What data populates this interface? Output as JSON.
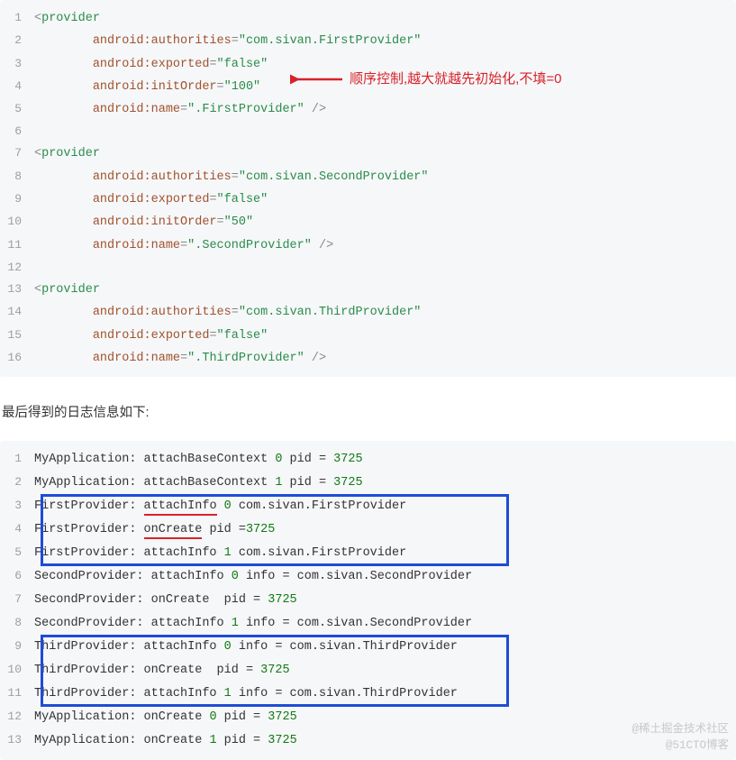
{
  "annotation": {
    "text": "顺序控制,越大就越先初始化,不填=0"
  },
  "sectionLabel": "最后得到的日志信息如下:",
  "watermarks": {
    "top": "@稀土掘金技术社区",
    "bottom": "@51CTO博客"
  },
  "xml": {
    "lines": [
      {
        "n": 1,
        "tokens": [
          {
            "t": "punc",
            "v": "<"
          },
          {
            "t": "tag",
            "v": "provider"
          }
        ]
      },
      {
        "n": 2,
        "tokens": [
          {
            "t": "txt",
            "v": "        "
          },
          {
            "t": "attr",
            "v": "android:authorities"
          },
          {
            "t": "punc",
            "v": "="
          },
          {
            "t": "str",
            "v": "\"com.sivan.FirstProvider\""
          }
        ]
      },
      {
        "n": 3,
        "tokens": [
          {
            "t": "txt",
            "v": "        "
          },
          {
            "t": "attr",
            "v": "android:exported"
          },
          {
            "t": "punc",
            "v": "="
          },
          {
            "t": "str",
            "v": "\"false\""
          }
        ]
      },
      {
        "n": 4,
        "tokens": [
          {
            "t": "txt",
            "v": "        "
          },
          {
            "t": "attr",
            "v": "android:initOrder"
          },
          {
            "t": "punc",
            "v": "="
          },
          {
            "t": "str",
            "v": "\"100\""
          }
        ]
      },
      {
        "n": 5,
        "tokens": [
          {
            "t": "txt",
            "v": "        "
          },
          {
            "t": "attr",
            "v": "android:name"
          },
          {
            "t": "punc",
            "v": "="
          },
          {
            "t": "str",
            "v": "\".FirstProvider\""
          },
          {
            "t": "txt",
            "v": " "
          },
          {
            "t": "punc",
            "v": "/>"
          }
        ]
      },
      {
        "n": 6,
        "tokens": []
      },
      {
        "n": 7,
        "tokens": [
          {
            "t": "punc",
            "v": "<"
          },
          {
            "t": "tag",
            "v": "provider"
          }
        ]
      },
      {
        "n": 8,
        "tokens": [
          {
            "t": "txt",
            "v": "        "
          },
          {
            "t": "attr",
            "v": "android:authorities"
          },
          {
            "t": "punc",
            "v": "="
          },
          {
            "t": "str",
            "v": "\"com.sivan.SecondProvider\""
          }
        ]
      },
      {
        "n": 9,
        "tokens": [
          {
            "t": "txt",
            "v": "        "
          },
          {
            "t": "attr",
            "v": "android:exported"
          },
          {
            "t": "punc",
            "v": "="
          },
          {
            "t": "str",
            "v": "\"false\""
          }
        ]
      },
      {
        "n": 10,
        "tokens": [
          {
            "t": "txt",
            "v": "        "
          },
          {
            "t": "attr",
            "v": "android:initOrder"
          },
          {
            "t": "punc",
            "v": "="
          },
          {
            "t": "str",
            "v": "\"50\""
          }
        ]
      },
      {
        "n": 11,
        "tokens": [
          {
            "t": "txt",
            "v": "        "
          },
          {
            "t": "attr",
            "v": "android:name"
          },
          {
            "t": "punc",
            "v": "="
          },
          {
            "t": "str",
            "v": "\".SecondProvider\""
          },
          {
            "t": "txt",
            "v": " "
          },
          {
            "t": "punc",
            "v": "/>"
          }
        ]
      },
      {
        "n": 12,
        "tokens": []
      },
      {
        "n": 13,
        "tokens": [
          {
            "t": "punc",
            "v": "<"
          },
          {
            "t": "tag",
            "v": "provider"
          }
        ]
      },
      {
        "n": 14,
        "tokens": [
          {
            "t": "txt",
            "v": "        "
          },
          {
            "t": "attr",
            "v": "android:authorities"
          },
          {
            "t": "punc",
            "v": "="
          },
          {
            "t": "str",
            "v": "\"com.sivan.ThirdProvider\""
          }
        ]
      },
      {
        "n": 15,
        "tokens": [
          {
            "t": "txt",
            "v": "        "
          },
          {
            "t": "attr",
            "v": "android:exported"
          },
          {
            "t": "punc",
            "v": "="
          },
          {
            "t": "str",
            "v": "\"false\""
          }
        ]
      },
      {
        "n": 16,
        "tokens": [
          {
            "t": "txt",
            "v": "        "
          },
          {
            "t": "attr",
            "v": "android:name"
          },
          {
            "t": "punc",
            "v": "="
          },
          {
            "t": "str",
            "v": "\".ThirdProvider\""
          },
          {
            "t": "txt",
            "v": " "
          },
          {
            "t": "punc",
            "v": "/>"
          }
        ]
      }
    ]
  },
  "log": {
    "lines": [
      {
        "n": 1,
        "segs": [
          {
            "t": "txt",
            "v": "MyApplication: attachBaseContext "
          },
          {
            "t": "num",
            "v": "0"
          },
          {
            "t": "txt",
            "v": " pid = "
          },
          {
            "t": "num",
            "v": "3725"
          }
        ]
      },
      {
        "n": 2,
        "segs": [
          {
            "t": "txt",
            "v": "MyApplication: attachBaseContext "
          },
          {
            "t": "num",
            "v": "1"
          },
          {
            "t": "txt",
            "v": " pid = "
          },
          {
            "t": "num",
            "v": "3725"
          }
        ]
      },
      {
        "n": 3,
        "segs": [
          {
            "t": "txt",
            "v": "FirstProvider: "
          },
          {
            "t": "ul",
            "v": "attachInfo"
          },
          {
            "t": "txt",
            "v": " "
          },
          {
            "t": "num",
            "v": "0"
          },
          {
            "t": "txt",
            "v": " com.sivan.FirstProvider"
          }
        ]
      },
      {
        "n": 4,
        "segs": [
          {
            "t": "txt",
            "v": "FirstProvider: "
          },
          {
            "t": "ul",
            "v": "onCreate"
          },
          {
            "t": "txt",
            "v": " pid ="
          },
          {
            "t": "num",
            "v": "3725"
          }
        ]
      },
      {
        "n": 5,
        "segs": [
          {
            "t": "txt",
            "v": "FirstProvider: attachInfo "
          },
          {
            "t": "num",
            "v": "1"
          },
          {
            "t": "txt",
            "v": " com.sivan.FirstProvider"
          }
        ]
      },
      {
        "n": 6,
        "segs": [
          {
            "t": "txt",
            "v": "SecondProvider: attachInfo "
          },
          {
            "t": "num",
            "v": "0"
          },
          {
            "t": "txt",
            "v": " info = com.sivan.SecondProvider"
          }
        ]
      },
      {
        "n": 7,
        "segs": [
          {
            "t": "txt",
            "v": "SecondProvider: onCreate  pid = "
          },
          {
            "t": "num",
            "v": "3725"
          }
        ]
      },
      {
        "n": 8,
        "segs": [
          {
            "t": "txt",
            "v": "SecondProvider: attachInfo "
          },
          {
            "t": "num",
            "v": "1"
          },
          {
            "t": "txt",
            "v": " info = com.sivan.SecondProvider"
          }
        ]
      },
      {
        "n": 9,
        "segs": [
          {
            "t": "txt",
            "v": "ThirdProvider: attachInfo "
          },
          {
            "t": "num",
            "v": "0"
          },
          {
            "t": "txt",
            "v": " info = com.sivan.ThirdProvider"
          }
        ]
      },
      {
        "n": 10,
        "segs": [
          {
            "t": "txt",
            "v": "ThirdProvider: onCreate  pid = "
          },
          {
            "t": "num",
            "v": "3725"
          }
        ]
      },
      {
        "n": 11,
        "segs": [
          {
            "t": "txt",
            "v": "ThirdProvider: attachInfo "
          },
          {
            "t": "num",
            "v": "1"
          },
          {
            "t": "txt",
            "v": " info = com.sivan.ThirdProvider"
          }
        ]
      },
      {
        "n": 12,
        "segs": [
          {
            "t": "txt",
            "v": "MyApplication: onCreate "
          },
          {
            "t": "num",
            "v": "0"
          },
          {
            "t": "txt",
            "v": " pid = "
          },
          {
            "t": "num",
            "v": "3725"
          }
        ]
      },
      {
        "n": 13,
        "segs": [
          {
            "t": "txt",
            "v": "MyApplication: onCreate "
          },
          {
            "t": "num",
            "v": "1"
          },
          {
            "t": "txt",
            "v": " pid = "
          },
          {
            "t": "num",
            "v": "3725"
          }
        ]
      }
    ],
    "highlightBoxes": [
      {
        "fromLine": 3,
        "toLine": 5
      },
      {
        "fromLine": 9,
        "toLine": 11
      }
    ]
  }
}
